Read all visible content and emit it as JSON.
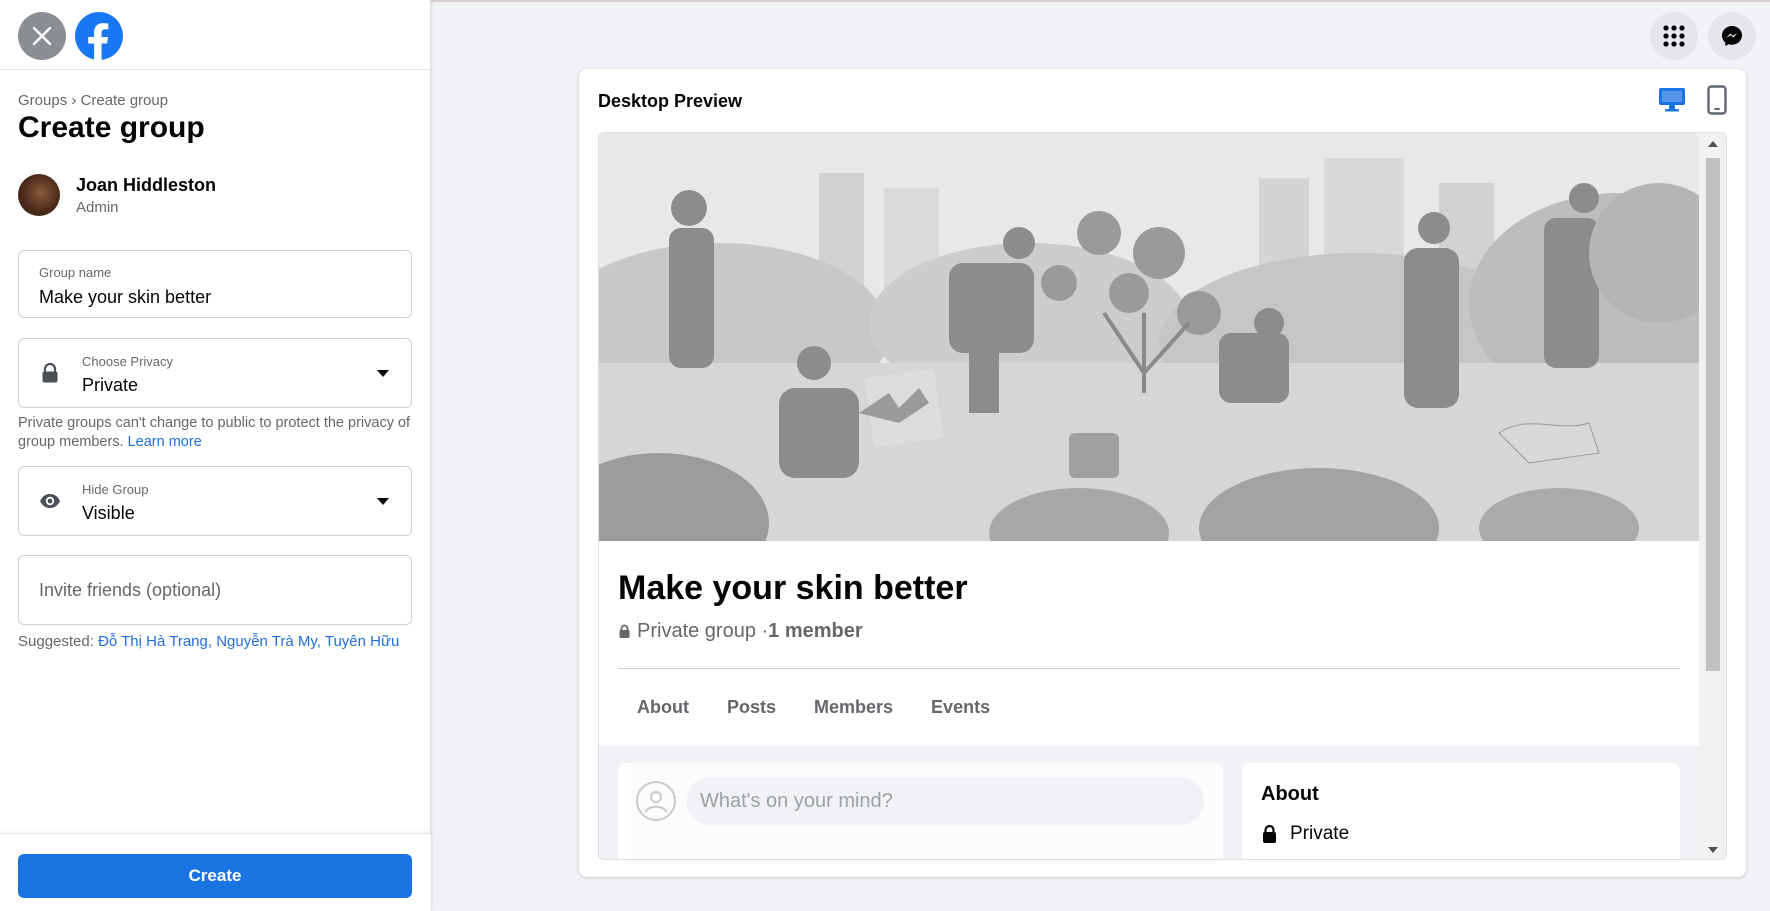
{
  "sidebar": {
    "breadcrumb": "Groups › Create group",
    "title": "Create group",
    "admin": {
      "name": "Joan Hiddleston",
      "role": "Admin"
    },
    "group_name": {
      "label": "Group name",
      "value": "Make your skin better"
    },
    "privacy": {
      "label": "Choose Privacy",
      "value": "Private",
      "help": "Private groups can't change to public to protect the privacy of group members.",
      "learn_more": "Learn more"
    },
    "hide_group": {
      "label": "Hide Group",
      "value": "Visible"
    },
    "invite": {
      "placeholder": "Invite friends (optional)"
    },
    "suggested": {
      "label": "Suggested:",
      "names": "Đỗ Thị Hà Trang, Nguyễn Trà My, Tuyên Hữu"
    },
    "create_button": "Create"
  },
  "preview": {
    "title": "Desktop Preview",
    "group_title": "Make your skin better",
    "privacy_text": "Private group · ",
    "members_text": "1 member",
    "tabs": [
      "About",
      "Posts",
      "Members",
      "Events"
    ],
    "composer_placeholder": "What's on your mind?",
    "about_title": "About",
    "about_private": "Private"
  },
  "colors": {
    "accent": "#1b74e4",
    "link": "#216fdb",
    "muted": "#65676b",
    "background": "#f0f2f5"
  },
  "icons": [
    "close-icon",
    "facebook-logo-icon",
    "lock-icon",
    "eye-icon",
    "chevron-down-icon",
    "grid-menu-icon",
    "messenger-icon",
    "desktop-icon",
    "mobile-icon",
    "profile-placeholder-icon"
  ]
}
